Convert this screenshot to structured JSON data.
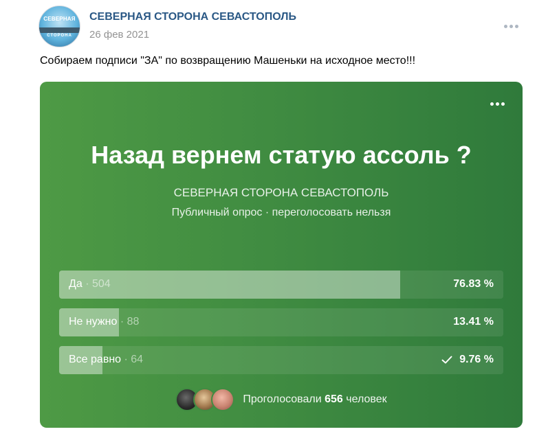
{
  "post": {
    "avatar": {
      "logo_top": "СЕВЕРНАЯ",
      "logo_bottom": "СТОРОНА"
    },
    "author": "СЕВЕРНАЯ СТОРОНА СЕВАСТОПОЛЬ",
    "date": "26 фев 2021",
    "menu_icon": "more-horizontal-icon",
    "text": "Собираем подписи \"ЗА\" по возвращению Машеньки на исходное место!!!"
  },
  "poll": {
    "colors": {
      "gradient_start": "#4e9a45",
      "gradient_end": "#2f7a3b",
      "text": "#ffffff"
    },
    "menu_icon": "more-horizontal-icon",
    "question": "Назад вернем статую ассоль ?",
    "author": "СЕВЕРНАЯ СТОРОНА СЕВАСТОПОЛЬ",
    "meta": "Публичный опрос · переголосовать нельзя",
    "answers": [
      {
        "label": "Да",
        "count_text": "· 504",
        "percent_text": "76.83 %",
        "fill_fraction": 0.7683,
        "voted": false
      },
      {
        "label": "Не нужно",
        "count_text": "· 88",
        "percent_text": "13.41 %",
        "fill_fraction": 0.1341,
        "voted": false
      },
      {
        "label": "Все равно",
        "count_text": "· 64",
        "percent_text": "9.76 %",
        "fill_fraction": 0.0976,
        "voted": true
      }
    ],
    "voted_icon": "check-icon",
    "voters": {
      "prefix": "Проголосовали",
      "count": "656",
      "suffix": "человек"
    }
  }
}
